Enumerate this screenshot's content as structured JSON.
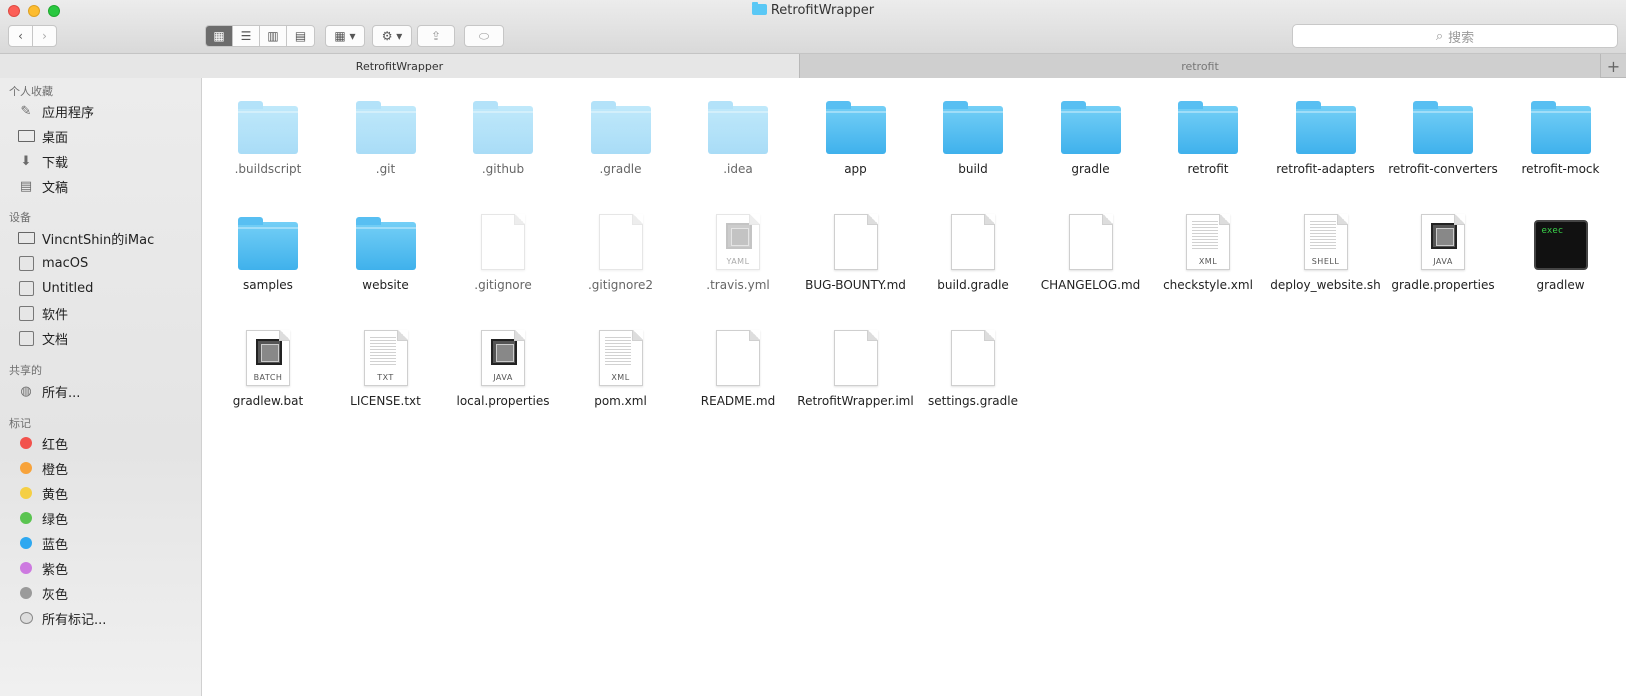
{
  "window": {
    "title": "RetrofitWrapper"
  },
  "toolbar": {
    "back_label": "‹",
    "forward_label": "›",
    "views": [
      "▦",
      "☰",
      "▥",
      "▤"
    ],
    "arrange_label": "▦ ▾",
    "action_label": "⚙ ▾",
    "share_label": "⇪",
    "tag_label": "⬭",
    "search_placeholder": "搜索"
  },
  "tabs": {
    "tab1": "RetrofitWrapper",
    "tab2": "retrofit",
    "add": "+"
  },
  "sidebar": {
    "favorites_header": "个人收藏",
    "favorites": [
      "应用程序",
      "桌面",
      "下载",
      "文稿"
    ],
    "devices_header": "设备",
    "devices": [
      "VincntShin的iMac",
      "macOS",
      "Untitled",
      "软件",
      "文档"
    ],
    "shared_header": "共享的",
    "shared": [
      "所有..."
    ],
    "tags_header": "标记",
    "tags": [
      {
        "label": "红色",
        "color": "#f2524c"
      },
      {
        "label": "橙色",
        "color": "#f7a33b"
      },
      {
        "label": "黄色",
        "color": "#f5cf44"
      },
      {
        "label": "绿色",
        "color": "#5ac450"
      },
      {
        "label": "蓝色",
        "color": "#2ea8f0"
      },
      {
        "label": "紫色",
        "color": "#cd7ae0"
      },
      {
        "label": "灰色",
        "color": "#9a9a9a"
      }
    ],
    "all_tags": "所有标记..."
  },
  "files": [
    {
      "name": ".buildscript",
      "type": "folder",
      "hidden": true
    },
    {
      "name": ".git",
      "type": "folder",
      "hidden": true
    },
    {
      "name": ".github",
      "type": "folder",
      "hidden": true
    },
    {
      "name": ".gradle",
      "type": "folder",
      "hidden": true
    },
    {
      "name": ".idea",
      "type": "folder",
      "hidden": true
    },
    {
      "name": "app",
      "type": "folder"
    },
    {
      "name": "build",
      "type": "folder"
    },
    {
      "name": "gradle",
      "type": "folder"
    },
    {
      "name": "retrofit",
      "type": "folder"
    },
    {
      "name": "retrofit-adapters",
      "type": "folder"
    },
    {
      "name": "retrofit-converters",
      "type": "folder"
    },
    {
      "name": "retrofit-mock",
      "type": "folder"
    },
    {
      "name": "samples",
      "type": "folder"
    },
    {
      "name": "website",
      "type": "folder"
    },
    {
      "name": ".gitignore",
      "type": "doc",
      "hidden": true
    },
    {
      "name": ".gitignore2",
      "type": "doc",
      "hidden": true
    },
    {
      "name": ".travis.yml",
      "type": "chipdoc",
      "badge": "YAML",
      "hidden": true
    },
    {
      "name": "BUG-BOUNTY.md",
      "type": "doc"
    },
    {
      "name": "build.gradle",
      "type": "doc"
    },
    {
      "name": "CHANGELOG.md",
      "type": "doc"
    },
    {
      "name": "checkstyle.xml",
      "type": "textdoc",
      "badge": "XML"
    },
    {
      "name": "deploy_website.sh",
      "type": "textdoc",
      "badge": "SHELL"
    },
    {
      "name": "gradle.properties",
      "type": "chipdoc",
      "badge": "JAVA"
    },
    {
      "name": "gradlew",
      "type": "exec",
      "badge": "exec"
    },
    {
      "name": "gradlew.bat",
      "type": "chipdoc",
      "badge": "BATCH"
    },
    {
      "name": "LICENSE.txt",
      "type": "textdoc",
      "badge": "TXT"
    },
    {
      "name": "local.properties",
      "type": "chipdoc",
      "badge": "JAVA"
    },
    {
      "name": "pom.xml",
      "type": "textdoc",
      "badge": "XML"
    },
    {
      "name": "README.md",
      "type": "doc"
    },
    {
      "name": "RetrofitWrapper.iml",
      "type": "doc"
    },
    {
      "name": "settings.gradle",
      "type": "doc"
    }
  ]
}
